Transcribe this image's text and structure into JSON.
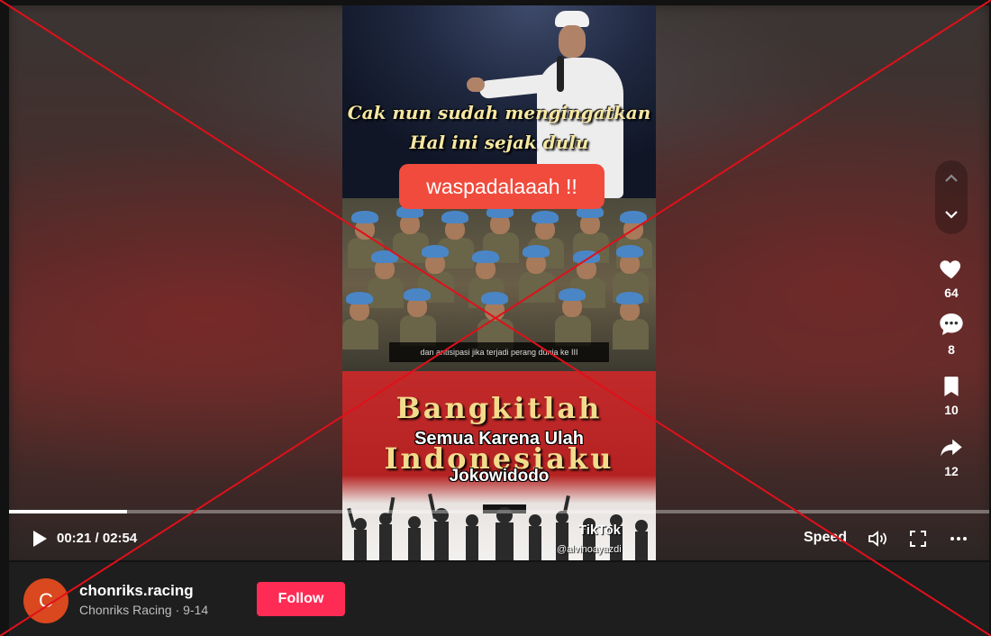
{
  "video": {
    "caption_line1": "Cak nun sudah mengingatkan",
    "caption_line2": "Hal ini sejak dulu",
    "alert_pill": "waspadalaaah !!",
    "subtitle": "dan antisipasi jika terjadi perang dunia ke III",
    "banner_line1": "Bangkitlah",
    "banner_line2": "Indonesiaku",
    "overlay_line1": "Semua Karena Ulah",
    "overlay_line2": "Jokowidodo",
    "watermark_logo": "TikTok",
    "watermark_handle": "@alvinoayazdi"
  },
  "player": {
    "progress_fraction": 0.12,
    "time": "00:21 / 02:54",
    "speed_label": "Speed",
    "icons": [
      "play-icon",
      "volume-icon",
      "fullscreen-icon",
      "more-icon"
    ]
  },
  "side_actions": {
    "likes": "64",
    "comments": "8",
    "saves": "10",
    "shares": "12",
    "icons": [
      "chevron-up-icon",
      "chevron-down-icon",
      "heart-icon",
      "comment-icon",
      "bookmark-icon",
      "share-icon"
    ]
  },
  "author": {
    "avatar_letter": "C",
    "username": "chonriks.racing",
    "subtitle": "Chonriks Racing · 9-14",
    "follow_label": "Follow"
  },
  "colors": {
    "follow": "#fe2c55",
    "avatar": "#d9481e",
    "strike": "#e0101a",
    "alert_pill": "#f04b3c"
  }
}
